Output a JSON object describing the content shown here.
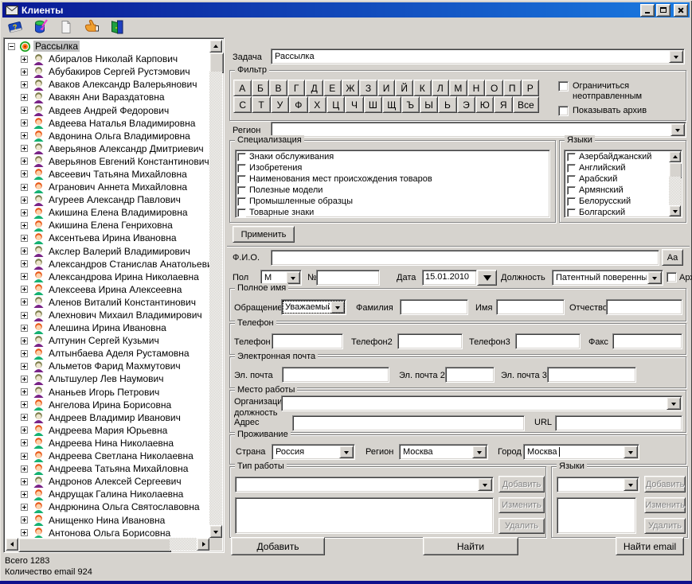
{
  "window": {
    "title": "Клиенты"
  },
  "toolbar": {
    "icons": [
      "address-book-icon",
      "database-export-icon",
      "new-document-icon",
      "hand-icon",
      "exit-door-icon"
    ]
  },
  "tree": {
    "root_label": "Рассылка",
    "items": [
      {
        "name": "Абиралов Николай Карпович",
        "g": "m"
      },
      {
        "name": "Абубакиров Сергей Рустэмович",
        "g": "m"
      },
      {
        "name": "Аваков Александр Валерьянович",
        "g": "m"
      },
      {
        "name": "Авакян Ани Вараздатовна",
        "g": "m"
      },
      {
        "name": "Авдеев Андрей Федорович",
        "g": "m"
      },
      {
        "name": "Авдеева Наталья Владимировна",
        "g": "f"
      },
      {
        "name": "Авдонина Ольга Владимировна",
        "g": "f"
      },
      {
        "name": "Аверьянов Александр Дмитриевич",
        "g": "m"
      },
      {
        "name": "Аверьянов Евгений Константинович",
        "g": "m"
      },
      {
        "name": "Авсеевич Татьяна Михайловна",
        "g": "f"
      },
      {
        "name": "Агранович Аннета Михайловна",
        "g": "f"
      },
      {
        "name": "Агуреев Александр Павлович",
        "g": "m"
      },
      {
        "name": "Акишина Елена Владимировна",
        "g": "f"
      },
      {
        "name": "Акишина Елена Генриховна",
        "g": "f"
      },
      {
        "name": "Аксентьева Ирина Ивановна",
        "g": "f"
      },
      {
        "name": "Акслер Валерий Владимирович",
        "g": "m"
      },
      {
        "name": "Александров Станислав Анатольевич",
        "g": "m"
      },
      {
        "name": "Александрова Ирина Николаевна",
        "g": "f"
      },
      {
        "name": "Алексеева Ирина Алексеевна",
        "g": "f"
      },
      {
        "name": "Аленов Виталий Константинович",
        "g": "m"
      },
      {
        "name": "Алехнович Михаил Владимирович",
        "g": "m"
      },
      {
        "name": "Алешина Ирина Ивановна",
        "g": "f"
      },
      {
        "name": "Алтунин Сергей Кузьмич",
        "g": "m"
      },
      {
        "name": "Алтынбаева Аделя Рустамовна",
        "g": "f"
      },
      {
        "name": "Альметов Фарид Махмутович",
        "g": "m"
      },
      {
        "name": "Альтшулер Лев Наумович",
        "g": "m"
      },
      {
        "name": "Ананьев Игорь Петрович",
        "g": "m"
      },
      {
        "name": "Ангелова Ирина Борисовна",
        "g": "f"
      },
      {
        "name": "Андреев Владимир Иванович",
        "g": "m"
      },
      {
        "name": "Андреева Мария Юрьевна",
        "g": "f"
      },
      {
        "name": "Андреева Нина Николаевна",
        "g": "f"
      },
      {
        "name": "Андреева Светлана Николаевна",
        "g": "f"
      },
      {
        "name": "Андреева Татьяна Михайловна",
        "g": "f"
      },
      {
        "name": "Андронов Алексей Сергеевич",
        "g": "m"
      },
      {
        "name": "Андрущак Галина Николаевна",
        "g": "f"
      },
      {
        "name": "Андрюнина Ольга Святославовна",
        "g": "f"
      },
      {
        "name": "Анищенко Нина Ивановна",
        "g": "f"
      },
      {
        "name": "Антонова Ольга Борисовна",
        "g": "f"
      }
    ]
  },
  "status": {
    "total": "Всего 1283",
    "email_count": "Количество email  924"
  },
  "form": {
    "task_label": "Задача",
    "task_value": "Рассылка",
    "filter": {
      "legend": "Фильтр",
      "row1": [
        "А",
        "Б",
        "В",
        "Г",
        "Д",
        "Е",
        "Ж",
        "З",
        "И",
        "Й",
        "К",
        "Л",
        "М",
        "Н",
        "О",
        "П",
        "Р"
      ],
      "row2": [
        "С",
        "Т",
        "У",
        "Ф",
        "Х",
        "Ц",
        "Ч",
        "Ш",
        "Щ",
        "Ъ",
        "Ы",
        "Ь",
        "Э",
        "Ю",
        "Я",
        "Все"
      ],
      "limit_unsent_label": "Ограничиться неотправленным",
      "show_archive_label": "Показывать архив"
    },
    "region_label": "Регион",
    "region_value": "",
    "specialization": {
      "legend": "Специализация",
      "items": [
        "Знаки обслуживания",
        "Изобретения",
        "Наименования мест происхождения товаров",
        "Полезные модели",
        "Промышленные образцы",
        "Товарные знаки"
      ]
    },
    "languages_filter": {
      "legend": "Языки",
      "items": [
        "Азербайджанский",
        "Английский",
        "Арабский",
        "Армянский",
        "Белорусский",
        "Болгарский",
        ""
      ]
    },
    "apply_label": "Применить",
    "fio_label": "Ф.И.О.",
    "fio_value": "",
    "case_button": "Аа",
    "gender_label": "Пол",
    "gender_value": "М",
    "number_label": "№",
    "number_value": "",
    "date_label": "Дата",
    "date_value": "15.01.2010",
    "position_label": "Должность",
    "position_value": "Патентный поверенный",
    "archive_label": "Архив",
    "full_name": {
      "legend": "Полное имя",
      "salutation_label": "Обращение",
      "salutation_value": "Уважаемый",
      "surname_label": "Фамилия",
      "surname_value": "",
      "firstname_label": "Имя",
      "firstname_value": "",
      "patronymic_label": "Отчество",
      "patronymic_value": ""
    },
    "phones": {
      "legend": "Телефон",
      "phone1_label": "Телефон",
      "phone2_label": "Телефон2",
      "phone3_label": "Телефон3",
      "fax_label": "Факс"
    },
    "emails": {
      "legend": "Электронная почта",
      "email1_label": "Эл. почта",
      "email2_label": "Эл. почта 2",
      "email3_label": "Эл. почта 3"
    },
    "work": {
      "legend": "Место работы",
      "org_label_line1": "Организация,",
      "org_label_line2": "должность",
      "address_label": "Адрес",
      "url_label": "URL"
    },
    "residence": {
      "legend": "Проживание",
      "country_label": "Страна",
      "country_value": "Россия",
      "region_label": "Регион",
      "region_value": "Москва",
      "city_label": "Город",
      "city_value": "Москва"
    },
    "work_type": {
      "legend": "Тип работы",
      "add_label": "Добавить",
      "edit_label": "Изменить",
      "delete_label": "Удалить"
    },
    "languages_edit": {
      "legend": "Языки",
      "add_label": "Добавить",
      "edit_label": "Изменить",
      "delete_label": "Удалить"
    },
    "buttons": {
      "add": "Добавить",
      "find": "Найти",
      "find_email": "Найти email"
    }
  },
  "colors": {
    "titlebar_left": "#0a1894",
    "titlebar_right": "#1a7ae0",
    "window_bg": "#d6d3ce",
    "selection_bg": "#c0c0c0",
    "disabled_text": "#848484",
    "bottom_edge": "#10108c"
  }
}
